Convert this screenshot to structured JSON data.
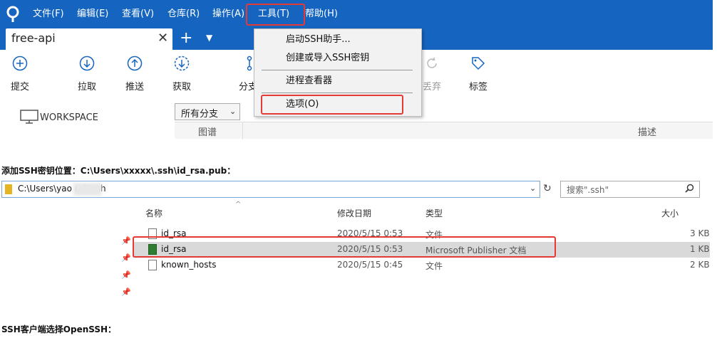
{
  "sourcetree": {
    "menu": {
      "file": "文件(F)",
      "edit": "编辑(E)",
      "view": "查看(V)",
      "repo": "仓库(R)",
      "actions": "操作(A)",
      "tools": "工具(T)",
      "help": "帮助(H)"
    },
    "tab": {
      "label": "free-api",
      "close_glyph": "✕",
      "add_glyph": "+",
      "dropdown_glyph": "▼"
    },
    "toolbar": {
      "commit": "提交",
      "pull": "拉取",
      "push": "推送",
      "fetch": "获取",
      "branch": "分支",
      "discard": "丢弃",
      "tag": "标签"
    },
    "tools_menu": {
      "launch_ssh": "启动SSH助手...",
      "create_ssh_key": "创建或导入SSH密钥",
      "process_viewer": "进程查看器",
      "options": "选项(O)"
    },
    "workspace": {
      "label": "WORKSPACE",
      "branch_filter": "所有分支",
      "branch_arrow": "⌄",
      "graph_col": "图谱",
      "desc_col": "描述"
    },
    "accent_color": "#1565c0",
    "highlight_color": "#e53935"
  },
  "captions": {
    "ssh_key_location": "添加SSH密钥位置：C:\\Users\\xxxxx\\.ssh\\id_rsa.pub：",
    "ssh_client": "SSH客户端选择OpenSSH："
  },
  "explorer": {
    "address_path": "C:\\Users\\yao           rui\\.ssh",
    "search_placeholder": "搜索\".ssh\"",
    "columns": {
      "name": "名称",
      "date": "修改日期",
      "type": "类型",
      "size": "大小"
    },
    "rows": [
      {
        "name": "id_rsa",
        "date": "2020/5/15 0:53",
        "type": "文件",
        "size": "3 KB"
      },
      {
        "name": "id_rsa",
        "date": "2020/5/15 0:53",
        "type": "Microsoft Publisher 文档",
        "size": "1 KB"
      },
      {
        "name": "known_hosts",
        "date": "2020/5/15 0:45",
        "type": "文件",
        "size": "2 KB"
      }
    ]
  }
}
